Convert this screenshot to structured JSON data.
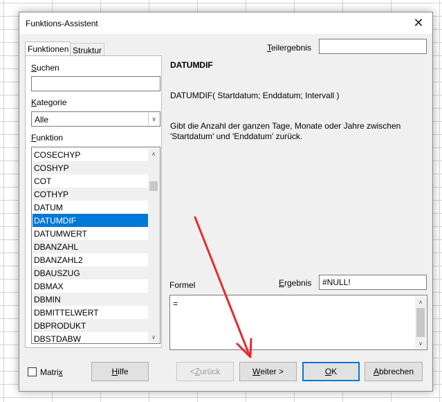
{
  "dialog": {
    "title": "Funktions-Assistent",
    "close_symbol": "✕"
  },
  "tabs": [
    {
      "label": "Funktionen"
    },
    {
      "label": "Struktur"
    }
  ],
  "search": {
    "label_u": "S",
    "label_rest": "uchen",
    "value": ""
  },
  "category": {
    "label_u": "K",
    "label_rest": "ategorie",
    "value": "Alle",
    "arrow": "∨"
  },
  "function_list": {
    "label_u": "F",
    "label_rest": "unktion",
    "items": [
      "COSECHYP",
      "COSHYP",
      "COT",
      "COTHYP",
      "DATUM",
      "DATUMDIF",
      "DATUMWERT",
      "DBANZAHL",
      "DBANZAHL2",
      "DBAUSZUG",
      "DBMAX",
      "DBMIN",
      "DBMITTELWERT",
      "DBPRODUKT",
      "DBSTDABW"
    ],
    "selected": "DATUMDIF",
    "scroll_up": "∧",
    "scroll_down": "∨"
  },
  "subtotal": {
    "label_u": "T",
    "label_rest": "eilergebnis",
    "value": ""
  },
  "function_info": {
    "name": "DATUMDIF",
    "syntax": "DATUMDIF( Startdatum; Enddatum; Intervall )",
    "description": "Gibt die Anzahl der ganzen Tage, Monate oder Jahre zwischen 'Startdatum' und 'Enddatum' zurück."
  },
  "formula": {
    "label": "Formel",
    "value": "="
  },
  "result": {
    "label_u": "E",
    "label_rest": "rgebnis",
    "value": "#NULL!"
  },
  "matrix": {
    "label_pre": "Matri",
    "label_u": "x",
    "checked": false
  },
  "buttons": {
    "help": {
      "u": "H",
      "rest": "ilfe"
    },
    "back": {
      "pre": "< ",
      "u": "Z",
      "rest": "urück"
    },
    "next": {
      "u": "W",
      "rest": "eiter >"
    },
    "ok": {
      "u": "O",
      "rest": "K"
    },
    "cancel": {
      "u": "A",
      "rest": "bbrechen"
    }
  },
  "colors": {
    "selection": "#0078d7",
    "annotation_arrow": "#e8282e"
  }
}
